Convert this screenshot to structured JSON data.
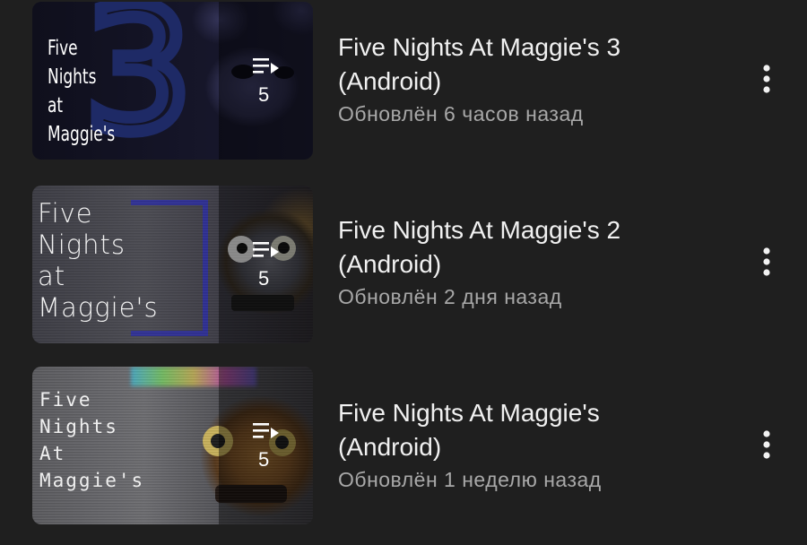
{
  "playlists": [
    {
      "thumb_title": "Five\nNights\nat\nMaggie's",
      "count": "5",
      "title": "Five Nights At Maggie's 3\n(Android)",
      "subtitle": "Обновлён 6 часов назад",
      "menu_icon": "more-vert-icon",
      "playlist_icon": "playlist-play-icon"
    },
    {
      "thumb_title": "Five\nNights\nat\nMaggie's",
      "count": "5",
      "title": "Five Nights At Maggie's 2\n(Android)",
      "subtitle": "Обновлён 2 дня назад",
      "menu_icon": "more-vert-icon",
      "playlist_icon": "playlist-play-icon"
    },
    {
      "thumb_title": "Five\nNights\nAt\nMaggie's",
      "count": "5",
      "title": "Five Nights At Maggie's\n(Android)",
      "subtitle": "Обновлён 1 неделю назад",
      "menu_icon": "more-vert-icon",
      "playlist_icon": "playlist-play-icon"
    }
  ],
  "colors": {
    "background": "#1f1f1f",
    "title": "#f1f1f1",
    "subtitle": "#a8a8a8"
  }
}
